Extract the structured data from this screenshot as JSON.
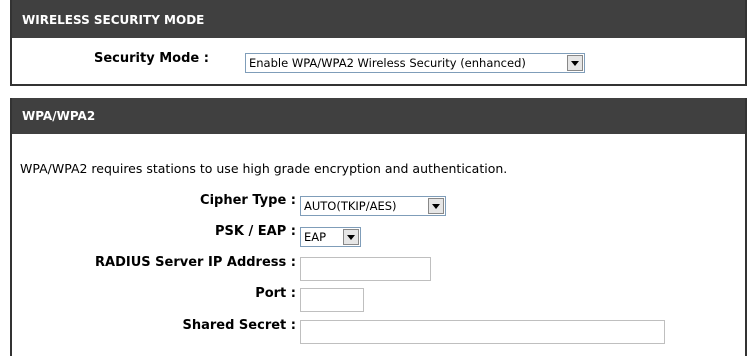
{
  "security_section": {
    "header": "WIRELESS SECURITY MODE",
    "mode_label": "Security Mode :",
    "mode_value": "Enable WPA/WPA2 Wireless Security (enhanced)"
  },
  "wpa_section": {
    "header": "WPA/WPA2",
    "description": "WPA/WPA2 requires stations to use high grade encryption and authentication.",
    "cipher_label": "Cipher Type :",
    "cipher_value": "AUTO(TKIP/AES)",
    "psk_label": "PSK / EAP :",
    "psk_value": "EAP",
    "radius_ip_label": "RADIUS Server IP Address :",
    "radius_ip_value": "",
    "port_label": "Port :",
    "port_value": "",
    "secret_label": "Shared Secret :",
    "secret_value": ""
  },
  "icons": {
    "dropdown": "chevron-down-icon"
  }
}
